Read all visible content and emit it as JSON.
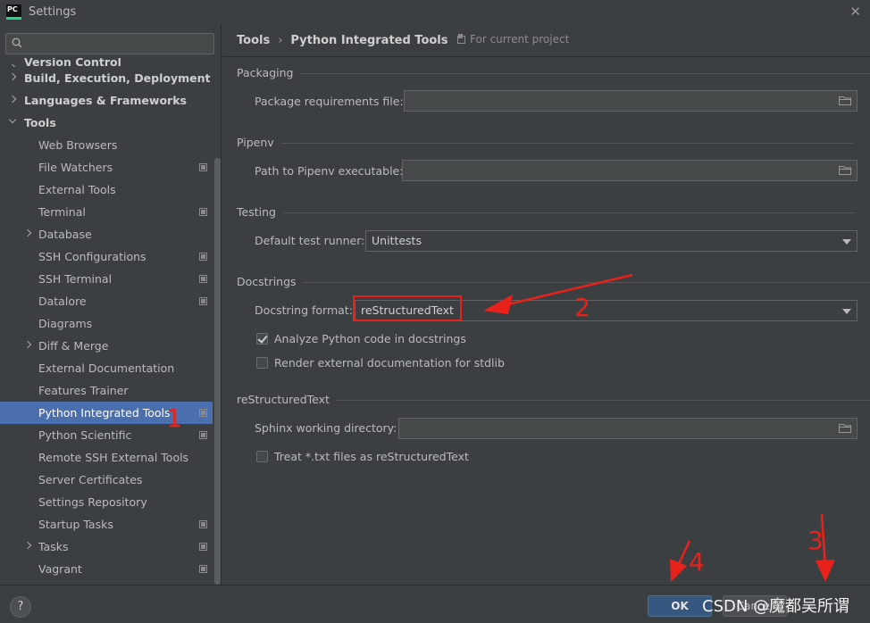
{
  "window": {
    "title": "Settings",
    "logo_text": "PC"
  },
  "sidebar": {
    "search_placeholder": "",
    "items": [
      {
        "label": "Version Control",
        "level": 0,
        "expand": "right",
        "project": false,
        "partial": true
      },
      {
        "label": "Build, Execution, Deployment",
        "level": 0,
        "expand": "right",
        "project": false
      },
      {
        "label": "Languages & Frameworks",
        "level": 0,
        "expand": "right",
        "project": false
      },
      {
        "label": "Tools",
        "level": 0,
        "expand": "down",
        "project": false
      },
      {
        "label": "Web Browsers",
        "level": 1,
        "expand": "",
        "project": false
      },
      {
        "label": "File Watchers",
        "level": 1,
        "expand": "",
        "project": true
      },
      {
        "label": "External Tools",
        "level": 1,
        "expand": "",
        "project": false
      },
      {
        "label": "Terminal",
        "level": 1,
        "expand": "",
        "project": true
      },
      {
        "label": "Database",
        "level": 1,
        "expand": "right",
        "project": false
      },
      {
        "label": "SSH Configurations",
        "level": 1,
        "expand": "",
        "project": true
      },
      {
        "label": "SSH Terminal",
        "level": 1,
        "expand": "",
        "project": true
      },
      {
        "label": "Datalore",
        "level": 1,
        "expand": "",
        "project": true
      },
      {
        "label": "Diagrams",
        "level": 1,
        "expand": "",
        "project": false
      },
      {
        "label": "Diff & Merge",
        "level": 1,
        "expand": "right",
        "project": false
      },
      {
        "label": "External Documentation",
        "level": 1,
        "expand": "",
        "project": false
      },
      {
        "label": "Features Trainer",
        "level": 1,
        "expand": "",
        "project": false
      },
      {
        "label": "Python Integrated Tools",
        "level": 1,
        "expand": "",
        "project": true,
        "selected": true
      },
      {
        "label": "Python Scientific",
        "level": 1,
        "expand": "",
        "project": true
      },
      {
        "label": "Remote SSH External Tools",
        "level": 1,
        "expand": "",
        "project": false
      },
      {
        "label": "Server Certificates",
        "level": 1,
        "expand": "",
        "project": false
      },
      {
        "label": "Settings Repository",
        "level": 1,
        "expand": "",
        "project": false
      },
      {
        "label": "Startup Tasks",
        "level": 1,
        "expand": "",
        "project": true
      },
      {
        "label": "Tasks",
        "level": 1,
        "expand": "right",
        "project": true
      },
      {
        "label": "Vagrant",
        "level": 1,
        "expand": "",
        "project": true
      }
    ]
  },
  "content": {
    "breadcrumb": [
      "Tools",
      "Python Integrated Tools"
    ],
    "for_project": "For current project",
    "packaging": {
      "title": "Packaging",
      "req_label": "Package requirements file:",
      "req_value": ""
    },
    "pipenv": {
      "title": "Pipenv",
      "path_label": "Path to Pipenv executable:",
      "path_value": ""
    },
    "testing": {
      "title": "Testing",
      "runner_label": "Default test runner:",
      "runner_value": "Unittests"
    },
    "docstrings": {
      "title": "Docstrings",
      "format_label": "Docstring format:",
      "format_value": "reStructuredText",
      "analyze_label": "Analyze Python code in docstrings",
      "analyze_checked": true,
      "render_label": "Render external documentation for stdlib",
      "render_checked": false
    },
    "rest": {
      "title": "reStructuredText",
      "sphinx_label": "Sphinx working directory:",
      "sphinx_value": "",
      "treat_label": "Treat *.txt files as reStructuredText",
      "treat_checked": false
    }
  },
  "footer": {
    "help": "?",
    "ok": "OK",
    "cancel": "Cancel",
    "watermark": "CSDN @魔都吴所谓"
  },
  "annotations": {
    "n1": "1",
    "n2": "2",
    "n3": "3",
    "n4": "4",
    "color": "#e8221b"
  }
}
